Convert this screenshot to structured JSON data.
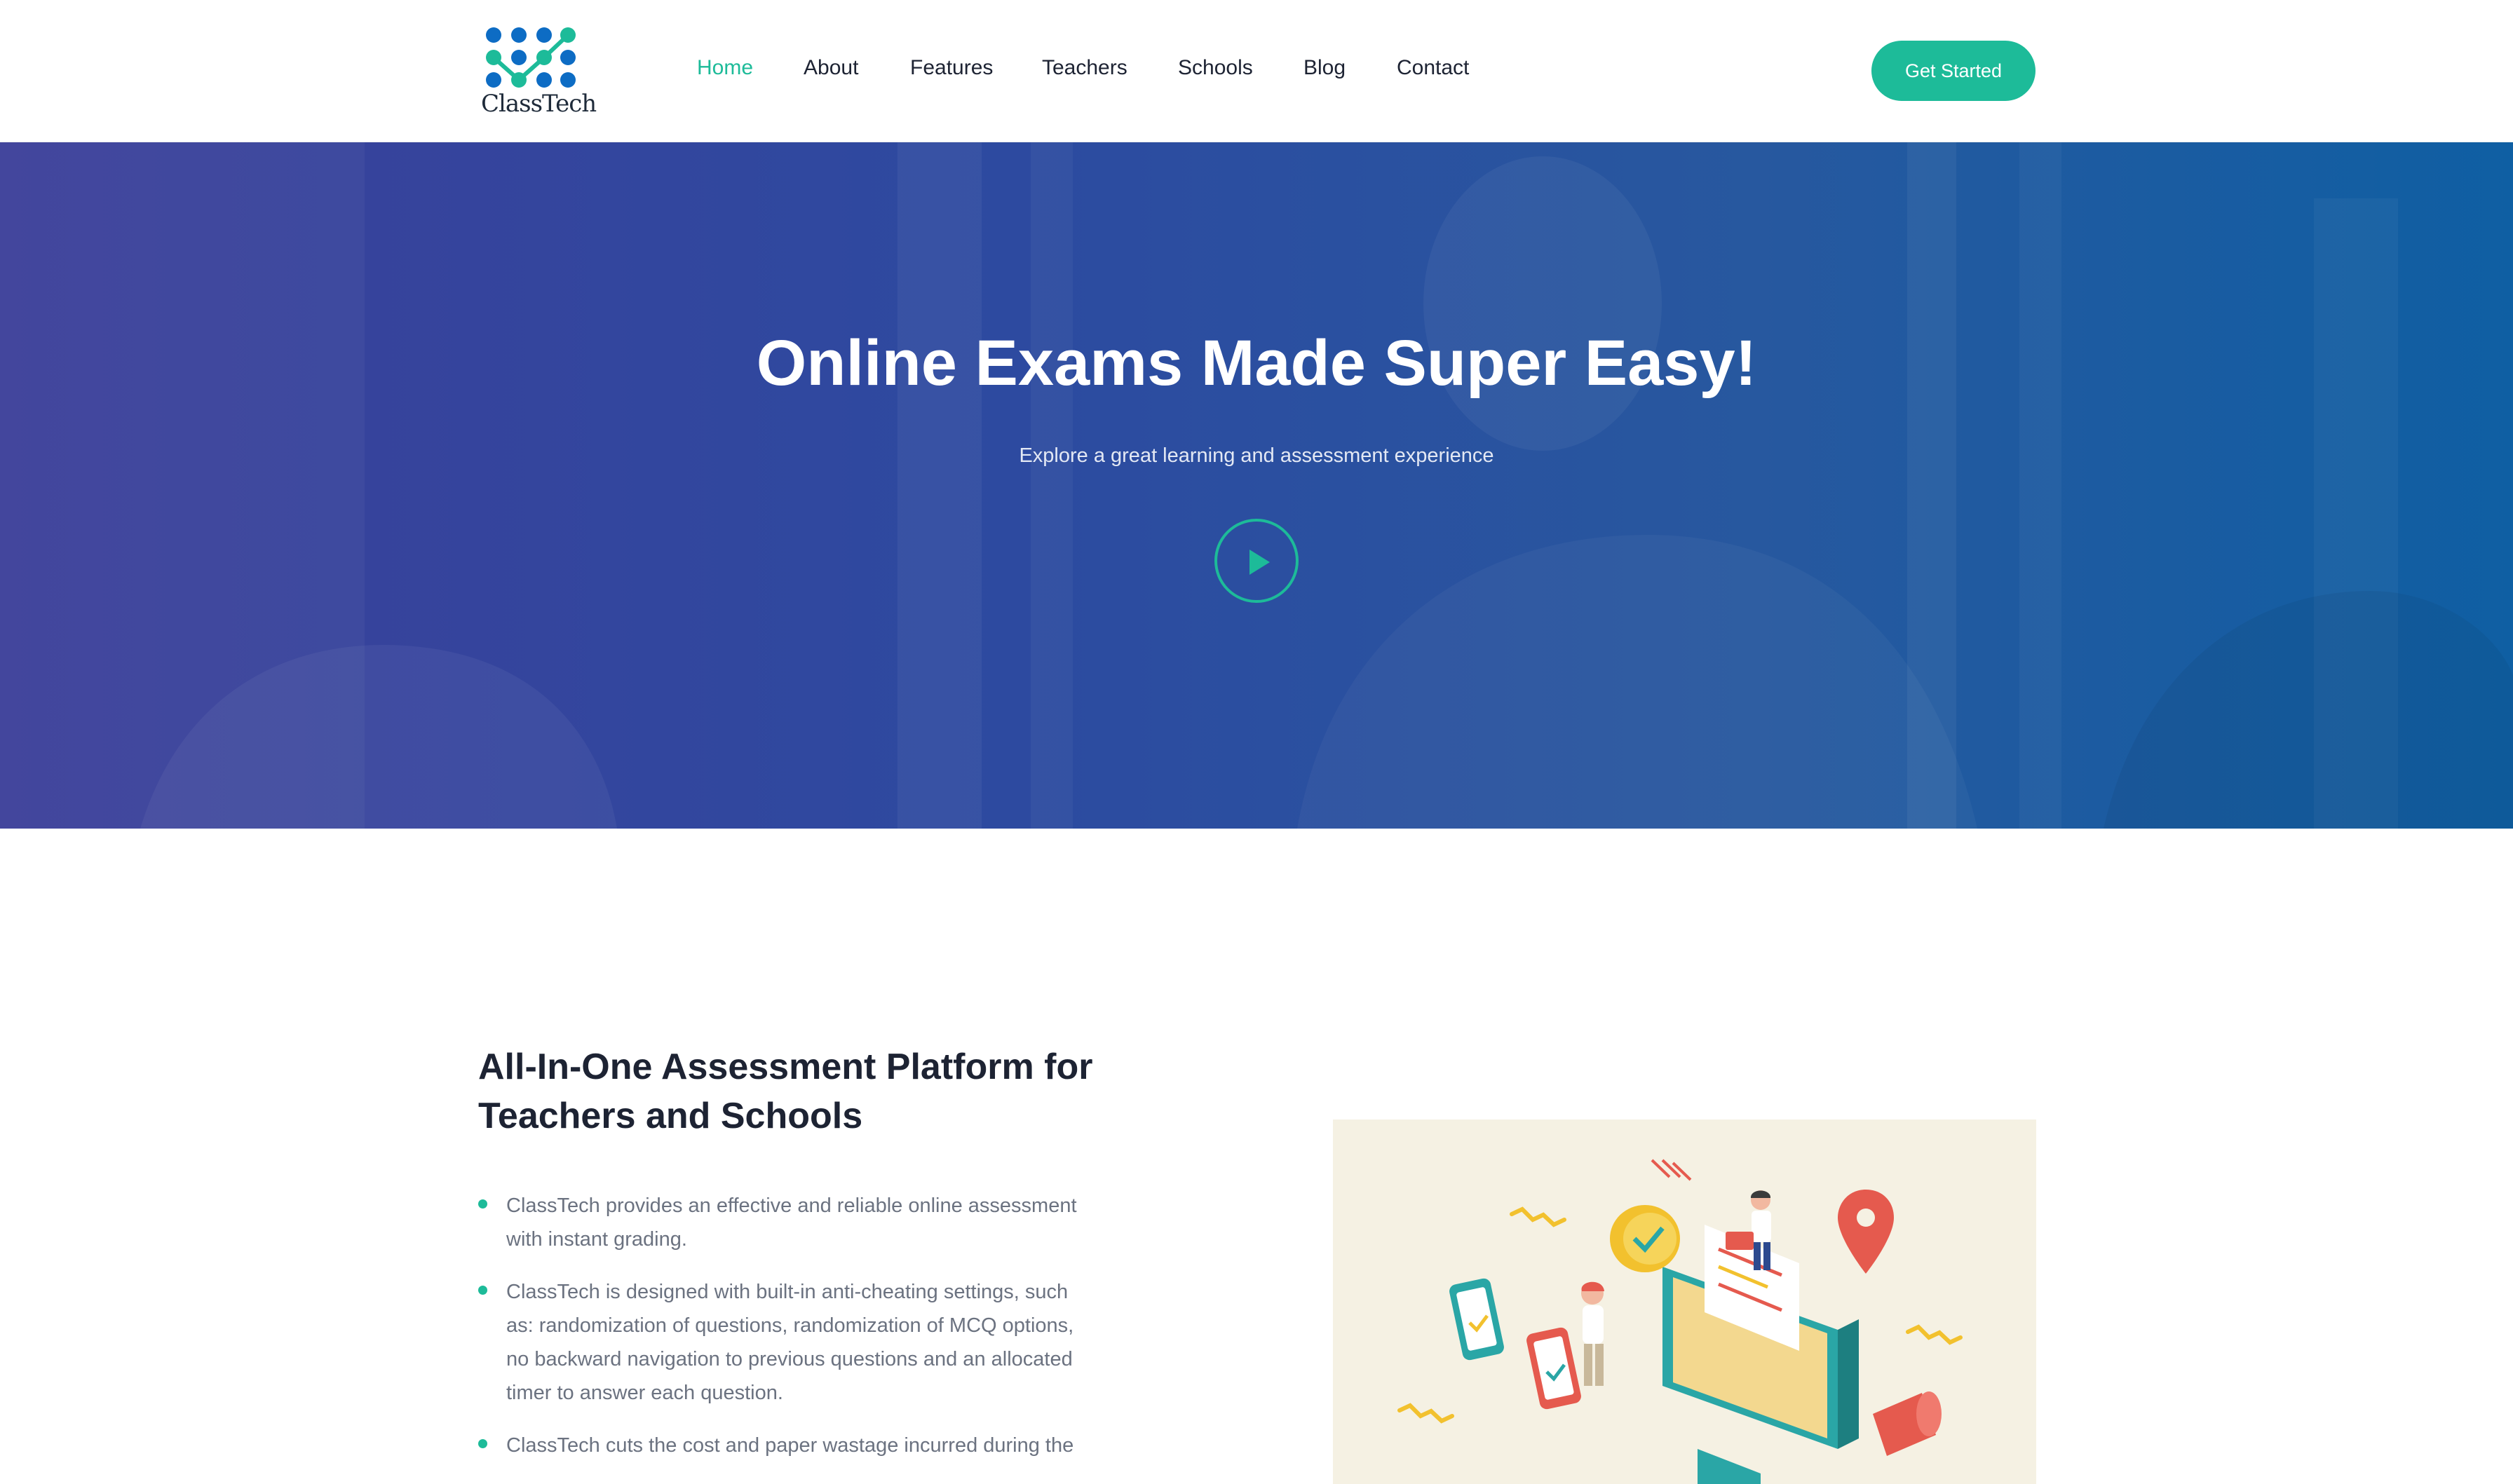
{
  "brand": {
    "name": "ClassTech",
    "accent_color": "#1dbb99",
    "dot_color": "#0d6cc4"
  },
  "nav": {
    "items": [
      {
        "label": "Home",
        "active": true
      },
      {
        "label": "About",
        "active": false
      },
      {
        "label": "Features",
        "active": false
      },
      {
        "label": "Teachers",
        "active": false
      },
      {
        "label": "Schools",
        "active": false
      },
      {
        "label": "Blog",
        "active": false
      },
      {
        "label": "Contact",
        "active": false
      }
    ],
    "cta_label": "Get Started"
  },
  "hero": {
    "title": "Online Exams Made Super Easy!",
    "subtitle": "Explore a great learning and assessment experience",
    "play_icon": "play-icon"
  },
  "about": {
    "title_line1": "All-In-One Assessment Platform for",
    "title_line2": "Teachers and Schools",
    "features": [
      {
        "line1": "ClassTech provides an effective and reliable online assessment",
        "line2": "with instant grading."
      },
      {
        "line1": "ClassTech is designed with built-in anti-cheating settings, such",
        "line2": "as: randomization of questions, randomization of MCQ options,",
        "line3": "no backward navigation to previous questions and an allocated",
        "line4": "timer to answer each question."
      },
      {
        "line1": "ClassTech cuts the cost and paper wastage incurred during the"
      }
    ]
  }
}
